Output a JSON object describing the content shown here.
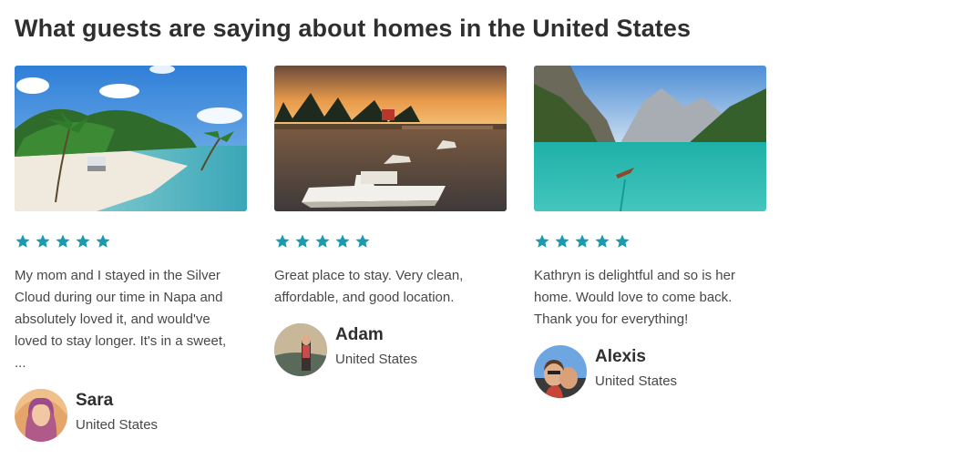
{
  "section": {
    "title": "What guests are saying about homes in the United States"
  },
  "theme": {
    "star_color": "#1a9aae"
  },
  "reviews": [
    {
      "rating": 5,
      "text": "My mom and I stayed in the Silver Cloud during our time in Napa and absolutely loved it, and would've loved to stay longer. It's in a sweet, ...",
      "author": "Sara",
      "country": "United States",
      "photo_icon": "tropical-beach-image"
    },
    {
      "rating": 5,
      "text": "Great place to stay. Very clean, affordable, and good location.",
      "author": "Adam",
      "country": "United States",
      "photo_icon": "lake-sunset-boats-image"
    },
    {
      "rating": 5,
      "text": "Kathryn is delightful and so is her home. Would love to come back. Thank you for everything!",
      "author": "Alexis",
      "country": "United States",
      "photo_icon": "mountain-lake-boat-image"
    }
  ]
}
